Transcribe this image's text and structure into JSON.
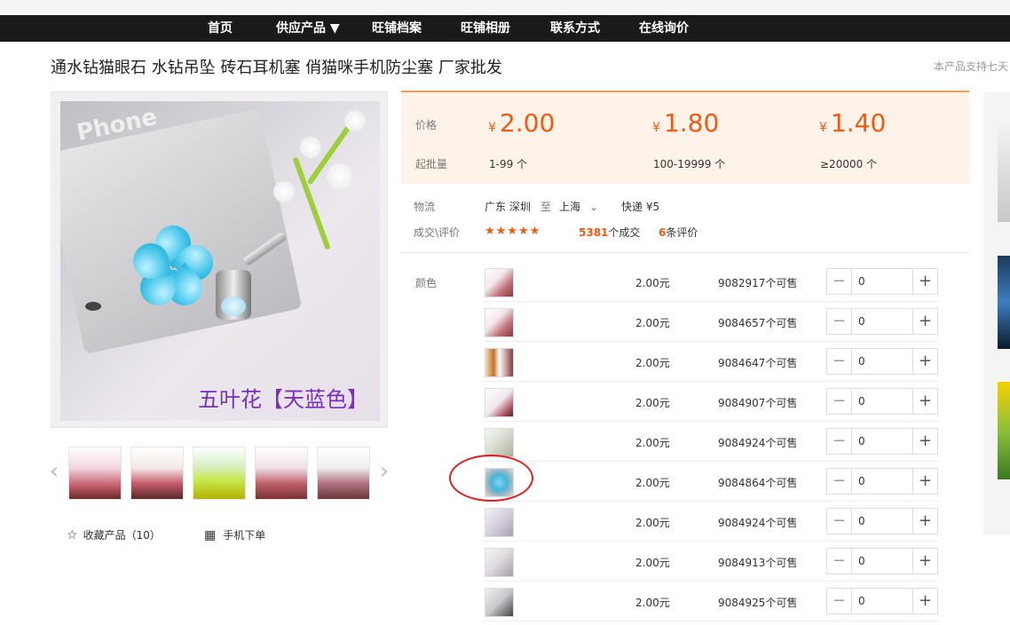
{
  "nav": {
    "items": [
      "首页",
      "供应产品 ▼",
      "旺铺档案",
      "旺铺相册",
      "联系方式",
      "在线询价"
    ]
  },
  "product": {
    "title": "通水钻猫眼石 水钻吊坠 砖石耳机塞 俏猫咪手机防尘塞 厂家批发",
    "note": "本产品支持七天",
    "image_caption": "五叶花【天蓝色】",
    "favorite_label": "收藏产品（10）",
    "mobile_label": "手机下单"
  },
  "pricing": {
    "price_label": "价格",
    "moq_label": "起批量",
    "currency": "¥",
    "tiers": [
      {
        "price": "2.00",
        "range": "1-99 个"
      },
      {
        "price": "1.80",
        "range": "100-19999 个"
      },
      {
        "price": "1.40",
        "range": "≥20000 个"
      }
    ]
  },
  "logistics": {
    "label": "物流",
    "from": "广东 深圳",
    "to_word": "至",
    "to": "上海",
    "express": "快递 ¥5",
    "deal_label": "成交\\评价",
    "stars": "★★★★★",
    "deals_count": "5381",
    "deals_suffix": "个成交",
    "reviews_count": "6",
    "reviews_suffix": "条评价"
  },
  "variants": {
    "label": "颜色",
    "rows": [
      {
        "price": "2.00元",
        "stock": "9082917个可售",
        "qty": "0"
      },
      {
        "price": "2.00元",
        "stock": "9084657个可售",
        "qty": "0"
      },
      {
        "price": "2.00元",
        "stock": "9084647个可售",
        "qty": "0"
      },
      {
        "price": "2.00元",
        "stock": "9084907个可售",
        "qty": "0"
      },
      {
        "price": "2.00元",
        "stock": "9084924个可售",
        "qty": "0"
      },
      {
        "price": "2.00元",
        "stock": "9084864个可售",
        "qty": "0"
      },
      {
        "price": "2.00元",
        "stock": "9084924个可售",
        "qty": "0"
      },
      {
        "price": "2.00元",
        "stock": "9084913个可售",
        "qty": "0"
      },
      {
        "price": "2.00元",
        "stock": "9084925个可售",
        "qty": "0"
      }
    ]
  },
  "colors": {
    "accent": "#f25a0f",
    "nav_bg": "#1a1a1a",
    "highlight_circle": "#e02020",
    "caption": "#7a2fc0"
  }
}
